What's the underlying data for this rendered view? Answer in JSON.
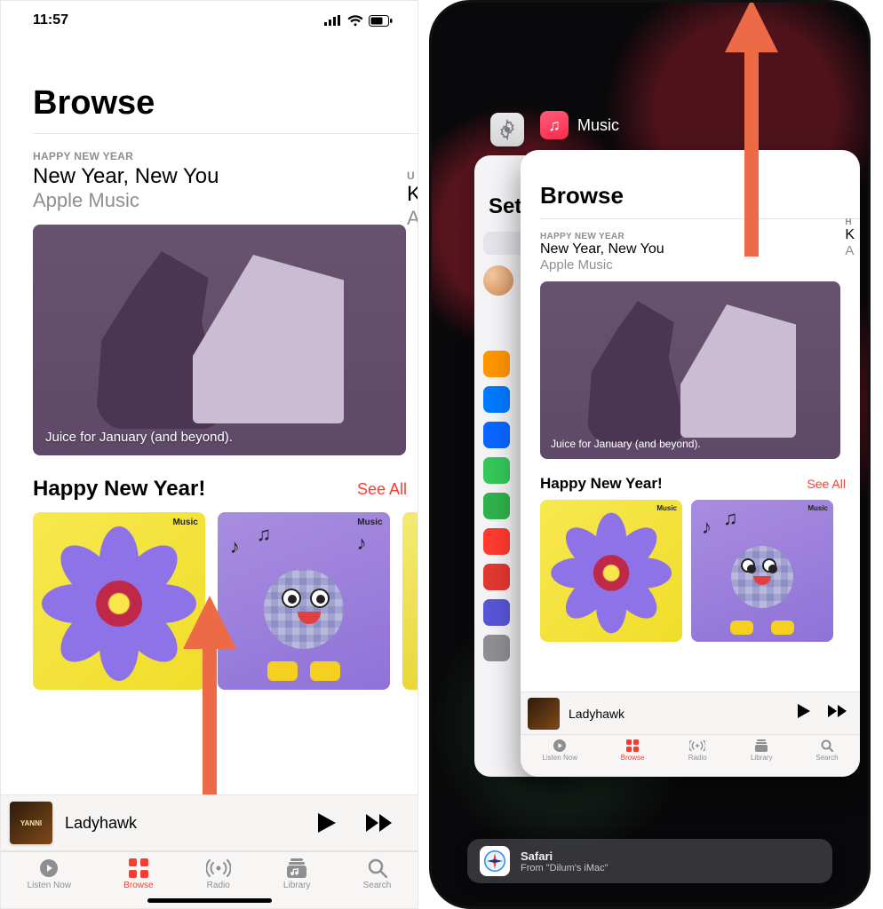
{
  "status_bar": {
    "time": "11:57"
  },
  "left_screen": {
    "page_title": "Browse",
    "feature": {
      "eyebrow": "HAPPY NEW YEAR",
      "title": "New Year, New You",
      "subtitle": "Apple Music",
      "art_caption": "Juice for January (and beyond)."
    },
    "feature_peek": {
      "eyebrow": "U",
      "title": "K",
      "subtitle": "A"
    },
    "section": {
      "title": "Happy New Year!",
      "see_all": "See All",
      "tile_tag": "Music"
    },
    "now_playing": {
      "track": "Ladyhawk",
      "art_label": "YANNI"
    },
    "tabs": {
      "listen_now": "Listen Now",
      "browse": "Browse",
      "radio": "Radio",
      "library": "Library",
      "search": "Search"
    }
  },
  "right_screen": {
    "music_label": "Music",
    "settings_card": {
      "title": "Sett"
    },
    "music_card": {
      "page_title": "Browse",
      "feature": {
        "eyebrow": "HAPPY NEW YEAR",
        "title": "New Year, New You",
        "subtitle": "Apple Music",
        "art_caption": "Juice for January (and beyond)."
      },
      "feature_peek": {
        "eyebrow": "H",
        "title": "K",
        "subtitle": "A"
      },
      "section": {
        "title": "Happy New Year!",
        "see_all": "See All",
        "tile_tag": "Music"
      },
      "now_playing": {
        "track": "Ladyhawk"
      },
      "tabs": {
        "listen_now": "Listen Now",
        "browse": "Browse",
        "radio": "Radio",
        "library": "Library",
        "search": "Search"
      }
    },
    "handoff": {
      "app": "Safari",
      "from": "From \"Dilum's iMac\""
    }
  },
  "colors": {
    "accent": "#fc3b30"
  }
}
